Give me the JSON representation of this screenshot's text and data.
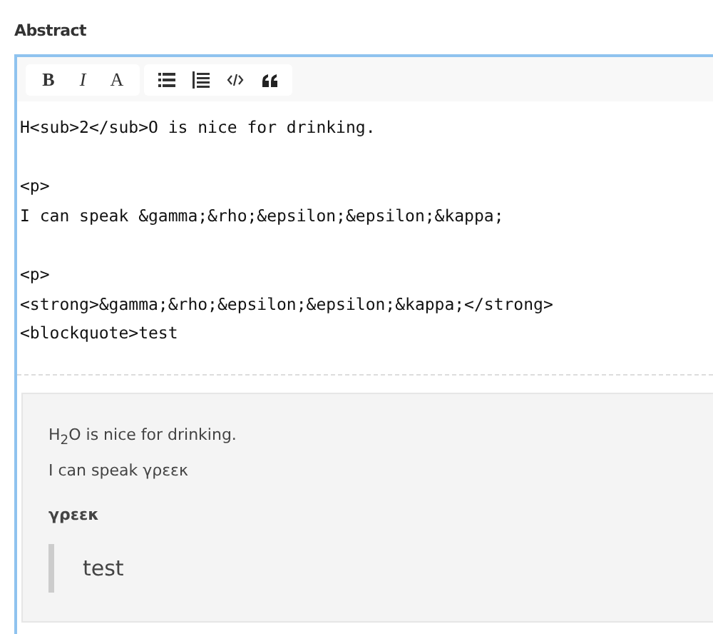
{
  "field_label": "Abstract",
  "toolbar_groups": [
    {
      "buttons": [
        {
          "kind": "bold",
          "label": "B"
        },
        {
          "kind": "italic",
          "label": "I"
        },
        {
          "kind": "font",
          "label": "A"
        }
      ]
    },
    {
      "buttons": [
        {
          "kind": "bullet-list"
        },
        {
          "kind": "numbered-list"
        },
        {
          "kind": "code"
        },
        {
          "kind": "quote"
        }
      ]
    }
  ],
  "source_blocks": [
    {
      "lines": [
        "H<sub>2</sub>O is nice for drinking."
      ]
    },
    {
      "lines": [
        "<p>",
        "I can speak &gamma;&rho;&epsilon;&epsilon;&kappa;"
      ]
    },
    {
      "lines": [
        "<p>",
        "<strong>&gamma;&rho;&epsilon;&epsilon;&kappa;</strong>",
        "<blockquote>test"
      ]
    }
  ],
  "preview": [
    {
      "kind": "paragraph",
      "text": "H$_{2}$O is nice for drinking."
    },
    {
      "kind": "paragraph",
      "text": "I can speak γρεεκ"
    },
    {
      "kind": "strong",
      "text": "γρεεκ"
    },
    {
      "kind": "blockquote",
      "text": "test"
    }
  ]
}
